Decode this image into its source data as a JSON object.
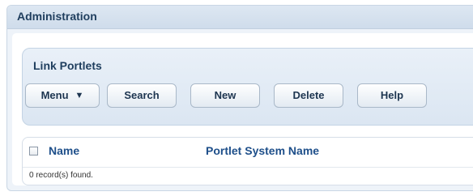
{
  "panel": {
    "title": "Administration"
  },
  "portlet": {
    "title": "Link Portlets",
    "buttons": {
      "menu": "Menu",
      "search": "Search",
      "new": "New",
      "delete": "Delete",
      "help": "Help"
    },
    "menu_icon": "menu-arrow-icon"
  },
  "grid": {
    "columns": [
      "Name",
      "Portlet System Name"
    ],
    "status": "0 record(s) found."
  },
  "colors": {
    "header_text": "#1f3e5e",
    "column_link": "#1e4f8a",
    "panel_bg": "#eef3f9",
    "toolbar_bg": "#dbe6f2"
  }
}
